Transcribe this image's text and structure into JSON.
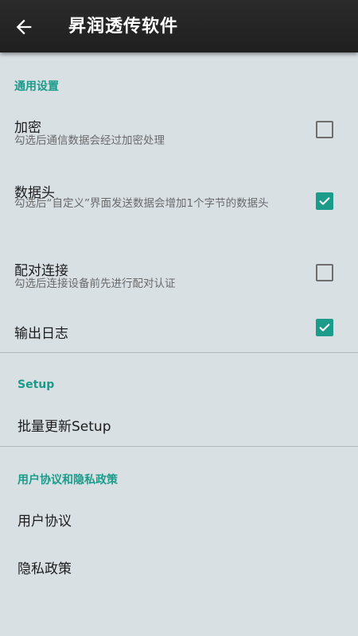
{
  "app_bar": {
    "title": "昇润透传软件"
  },
  "sections": {
    "general": {
      "header": "通用设置",
      "encrypt": {
        "title": "加密",
        "summary": "勾选后通信数据会经过加密处理",
        "checked": false
      },
      "data_header": {
        "title": "数据头",
        "summary": "勾选后“自定义”界面发送数据会增加1个字节的数据头",
        "checked": true
      },
      "pairing": {
        "title": "配对连接",
        "summary": "勾选后连接设备前先进行配对认证",
        "checked": false
      },
      "log_output": {
        "title": "输出日志",
        "checked": true
      }
    },
    "setup": {
      "header": "Setup",
      "batch_update": {
        "title": "批量更新Setup"
      }
    },
    "privacy": {
      "header": "用户协议和隐私政策",
      "user_agreement": {
        "title": "用户协议"
      },
      "privacy_policy": {
        "title": "隐私政策"
      }
    }
  },
  "colors": {
    "accent": "#1b9b8a",
    "app_bar": "#232323",
    "background": "#d8e0e4"
  },
  "icons": {
    "back": "arrow-left-icon",
    "check": "checkmark-icon"
  }
}
